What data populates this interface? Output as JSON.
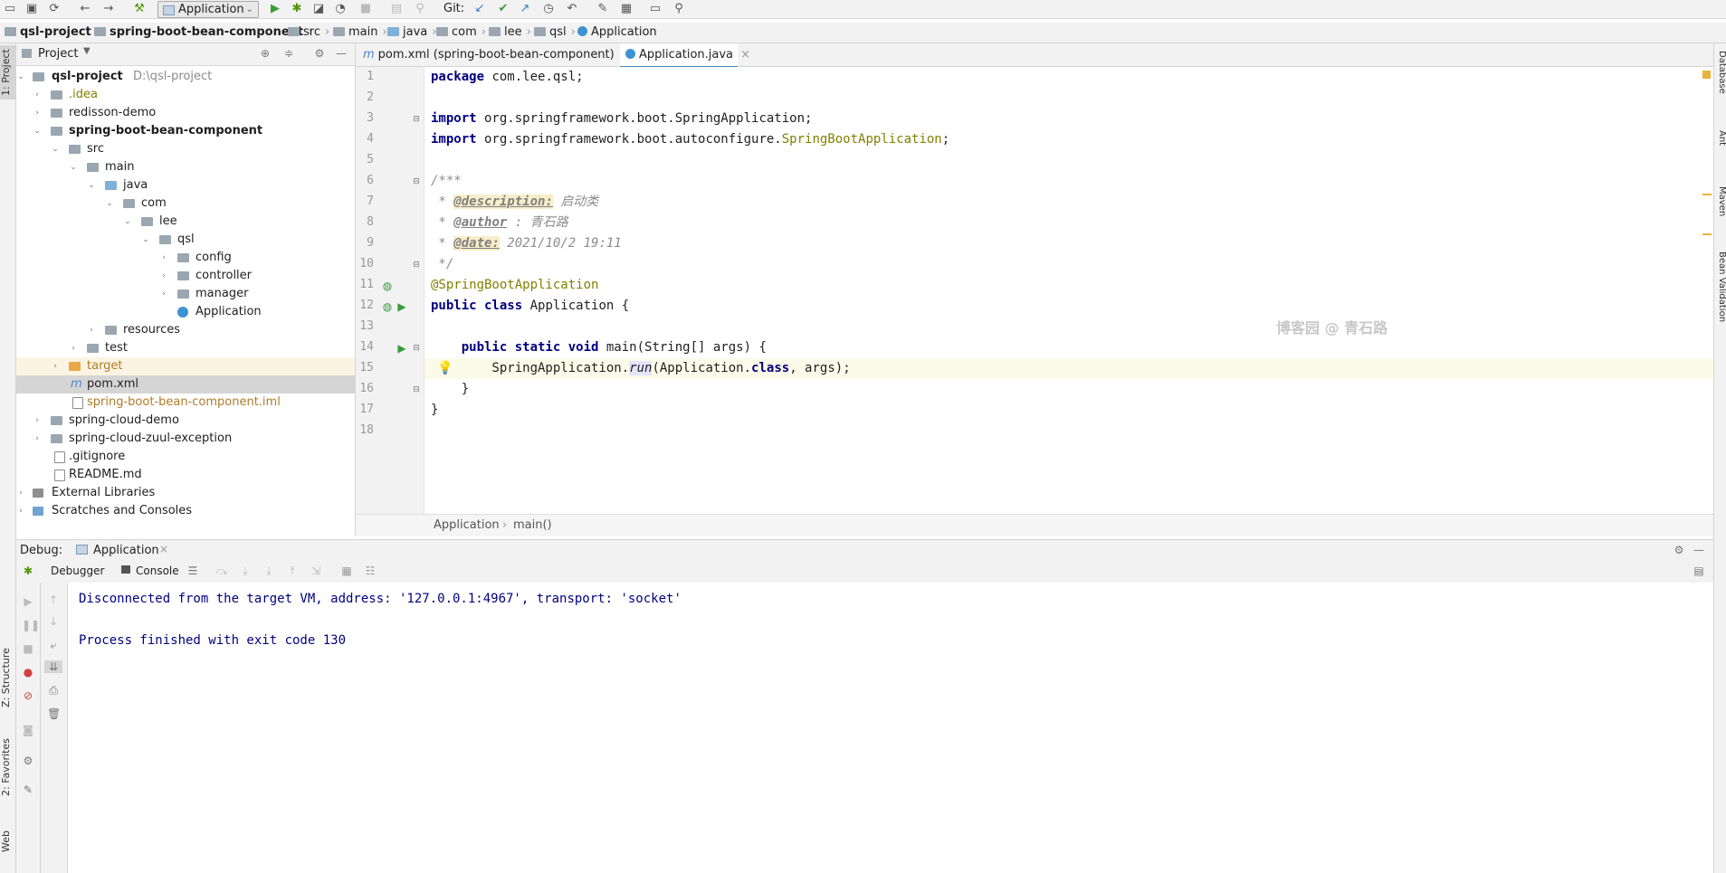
{
  "toolbar": {
    "run_config": "Application",
    "git_label": "Git:"
  },
  "breadcrumb": [
    "qsl-project",
    "spring-boot-bean-component",
    "src",
    "main",
    "java",
    "com",
    "lee",
    "qsl",
    "Application"
  ],
  "left_stripe": {
    "project": "1: Project",
    "structure": "Z: Structure",
    "favorites": "2: Favorites",
    "web": "Web"
  },
  "right_stripe": {
    "database": "Database",
    "ant": "Ant",
    "maven": "Maven",
    "bean_validation": "Bean Validation"
  },
  "project_panel": {
    "title": "Project",
    "tree": [
      {
        "label": "qsl-project",
        "suffix": "D:\\qsl-project",
        "bold": true
      },
      {
        "label": ".idea"
      },
      {
        "label": "redisson-demo"
      },
      {
        "label": "spring-boot-bean-component",
        "bold": true
      },
      {
        "label": "src"
      },
      {
        "label": "main"
      },
      {
        "label": "java"
      },
      {
        "label": "com"
      },
      {
        "label": "lee"
      },
      {
        "label": "qsl"
      },
      {
        "label": "config"
      },
      {
        "label": "controller"
      },
      {
        "label": "manager"
      },
      {
        "label": "Application"
      },
      {
        "label": "resources"
      },
      {
        "label": "test"
      },
      {
        "label": "target"
      },
      {
        "label": "pom.xml"
      },
      {
        "label": "spring-boot-bean-component.iml"
      },
      {
        "label": "spring-cloud-demo"
      },
      {
        "label": "spring-cloud-zuul-exception"
      },
      {
        "label": ".gitignore"
      },
      {
        "label": "README.md"
      },
      {
        "label": "External Libraries"
      },
      {
        "label": "Scratches and Consoles"
      }
    ]
  },
  "editor": {
    "tabs": [
      {
        "label": "pom.xml (spring-boot-bean-component)"
      },
      {
        "label": "Application.java"
      }
    ],
    "line_numbers": [
      "1",
      "2",
      "3",
      "4",
      "5",
      "6",
      "7",
      "8",
      "9",
      "10",
      "11",
      "12",
      "13",
      "14",
      "15",
      "16",
      "17",
      "18"
    ],
    "code": {
      "l1_kw": "package",
      "l1_rest": " com.lee.qsl;",
      "l3_kw": "import",
      "l3_rest": " org.springframework.boot.SpringApplication;",
      "l4_kw": "import",
      "l4_rest": " org.springframework.boot.autoconfigure.",
      "l4_ann": "SpringBootApplication",
      "l4_end": ";",
      "l6": "/***",
      "l7_pre": " * ",
      "l7_tag": "@description:",
      "l7_text": " 启动类",
      "l8_pre": " * ",
      "l8_tag": "@author",
      "l8_text": " : 青石路",
      "l9_pre": " * ",
      "l9_tag": "@date:",
      "l9_text": " 2021/10/2 19:11",
      "l10": " */",
      "l11": "@SpringBootApplication",
      "l12_kw": "public class",
      "l12_rest": " Application {",
      "l14_kw": "    public static void",
      "l14_rest": " main(String[] args) {",
      "l15_a": "        SpringApplication.",
      "l15_run": "run",
      "l15_b": "(Application.",
      "l15_kw": "class",
      "l15_c": ", args);",
      "l16": "    }",
      "l17": "}"
    },
    "crumb": [
      "Application",
      "main()"
    ],
    "watermark": "博客园 @ 青石路"
  },
  "debug": {
    "label": "Debug:",
    "session_tab": "Application",
    "tabs": [
      "Debugger",
      "Console"
    ],
    "console_lines": [
      "Disconnected from the target VM, address: '127.0.0.1:4967', transport: 'socket'",
      "",
      "Process finished with exit code 130"
    ]
  }
}
